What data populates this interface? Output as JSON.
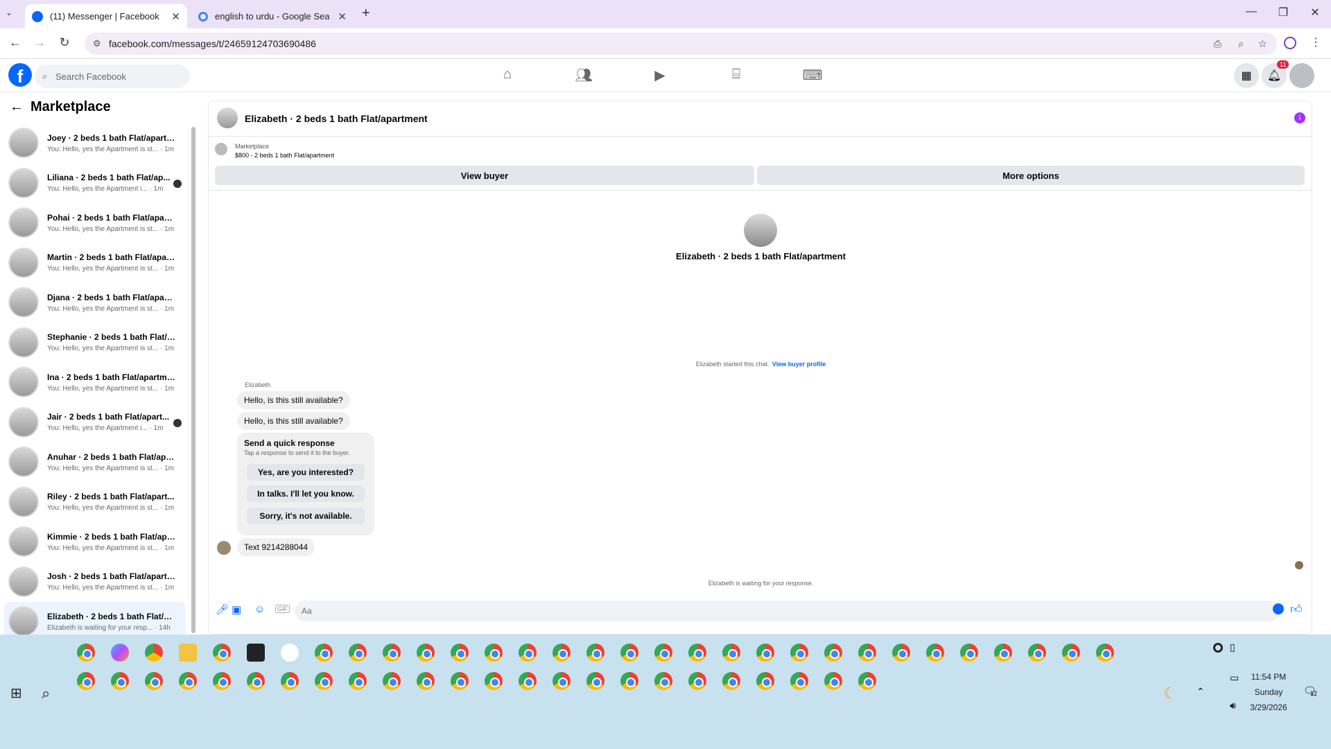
{
  "browser": {
    "tabs": [
      {
        "title": "(11) Messenger | Facebook"
      },
      {
        "title": "english to urdu - Google Search"
      }
    ],
    "url": "facebook.com/messages/t/24659124703690486"
  },
  "facebook": {
    "search_placeholder": "Search Facebook",
    "notification_count": "11"
  },
  "sidebar": {
    "title": "Marketplace",
    "conversations": [
      {
        "name": "Joey · 2 beds 1 bath Flat/apartm...",
        "preview": "You: Hello, yes the Apartment is st...",
        "time": "· 1m"
      },
      {
        "name": "Liliana · 2 beds 1 bath Flat/ap...",
        "preview": "You: Hello, yes the Apartment i...",
        "time": "· 1m"
      },
      {
        "name": "Pohai · 2 beds 1 bath Flat/apart...",
        "preview": "You: Hello, yes the Apartment is st...",
        "time": "· 1m"
      },
      {
        "name": "Martin · 2 beds 1 bath Flat/apar...",
        "preview": "You: Hello, yes the Apartment is st...",
        "time": "· 1m"
      },
      {
        "name": "Djana · 2 beds 1 bath Flat/apart...",
        "preview": "You: Hello, yes the Apartment is st...",
        "time": "· 1m"
      },
      {
        "name": "Stephanie · 2 beds 1 bath Flat/a...",
        "preview": "You: Hello, yes the Apartment is st...",
        "time": "· 1m"
      },
      {
        "name": "Ina · 2 beds 1 bath Flat/apartment",
        "preview": "You: Hello, yes the Apartment is st...",
        "time": "· 1m"
      },
      {
        "name": "Jair · 2 beds 1 bath Flat/apart...",
        "preview": "You: Hello, yes the Apartment i...",
        "time": "· 1m"
      },
      {
        "name": "Anuhar · 2 beds 1 bath Flat/apa...",
        "preview": "You: Hello, yes the Apartment is st...",
        "time": "· 1m"
      },
      {
        "name": "Riley · 2 beds 1 bath Flat/apart...",
        "preview": "You: Hello, yes the Apartment is st...",
        "time": "· 1m"
      },
      {
        "name": "Kimmie · 2 beds 1 bath Flat/apa...",
        "preview": "You: Hello, yes the Apartment is st...",
        "time": "· 1m"
      },
      {
        "name": "Josh · 2 beds 1 bath Flat/apartm...",
        "preview": "You: Hello, yes the Apartment is st...",
        "time": "· 1m"
      },
      {
        "name": "Elizabeth · 2 beds 1 bath Flat/ap...",
        "preview": "Elizabeth is waiting for your resp...",
        "time": "· 14h"
      }
    ]
  },
  "chat": {
    "header_title": "Elizabeth · 2 beds 1 bath Flat/apartment",
    "listing_source": "Marketplace",
    "listing_price": "$800 - 2 beds 1 bath Flat/apartment",
    "view_buyer": "View buyer",
    "more_options": "More options",
    "profile_name": "Elizabeth · 2 beds 1 bath Flat/apartment",
    "started_text": "Elizabeth started this chat.",
    "view_buyer_profile": "View buyer profile",
    "sender_label": "Elizabeth",
    "messages": [
      "Hello, is this still available?",
      "Hello, is this still available?"
    ],
    "quick_title": "Send a quick response",
    "quick_subtitle": "Tap a response to send it to the buyer.",
    "quick_options": [
      "Yes, are you interested?",
      "In talks. I'll let you know.",
      "Sorry, it's not available."
    ],
    "last_message": "Text 9214288044",
    "waiting_text": "Elizabeth is waiting for your response.",
    "input_placeholder": "Aa"
  },
  "taskbar": {
    "time": "11:54 PM",
    "day": "Sunday",
    "date": "3/29/2026",
    "notif_count": "12"
  },
  "colors": {
    "fb_blue": "#0866ff",
    "accent_purple": "#a033ff"
  }
}
